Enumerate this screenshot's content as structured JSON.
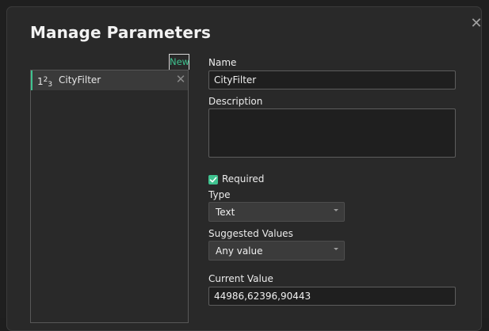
{
  "dialog": {
    "title": "Manage Parameters",
    "close_glyph": "✕"
  },
  "parameter_list": {
    "new_label": "New",
    "items": [
      {
        "type_icon": "text-type-icon",
        "name": "CityFilter",
        "remove_glyph": "✕"
      }
    ]
  },
  "form": {
    "name_label": "Name",
    "name_value": "CityFilter",
    "description_label": "Description",
    "description_value": "",
    "required_label": "Required",
    "required_checked": true,
    "type_label": "Type",
    "type_value": "Text",
    "suggested_values_label": "Suggested Values",
    "suggested_values_value": "Any value",
    "current_value_label": "Current Value",
    "current_value": "44986,62396,90443"
  },
  "colors": {
    "accent": "#3fc28f",
    "dialog_bg": "#292929",
    "input_bg": "#1f1f1f"
  }
}
